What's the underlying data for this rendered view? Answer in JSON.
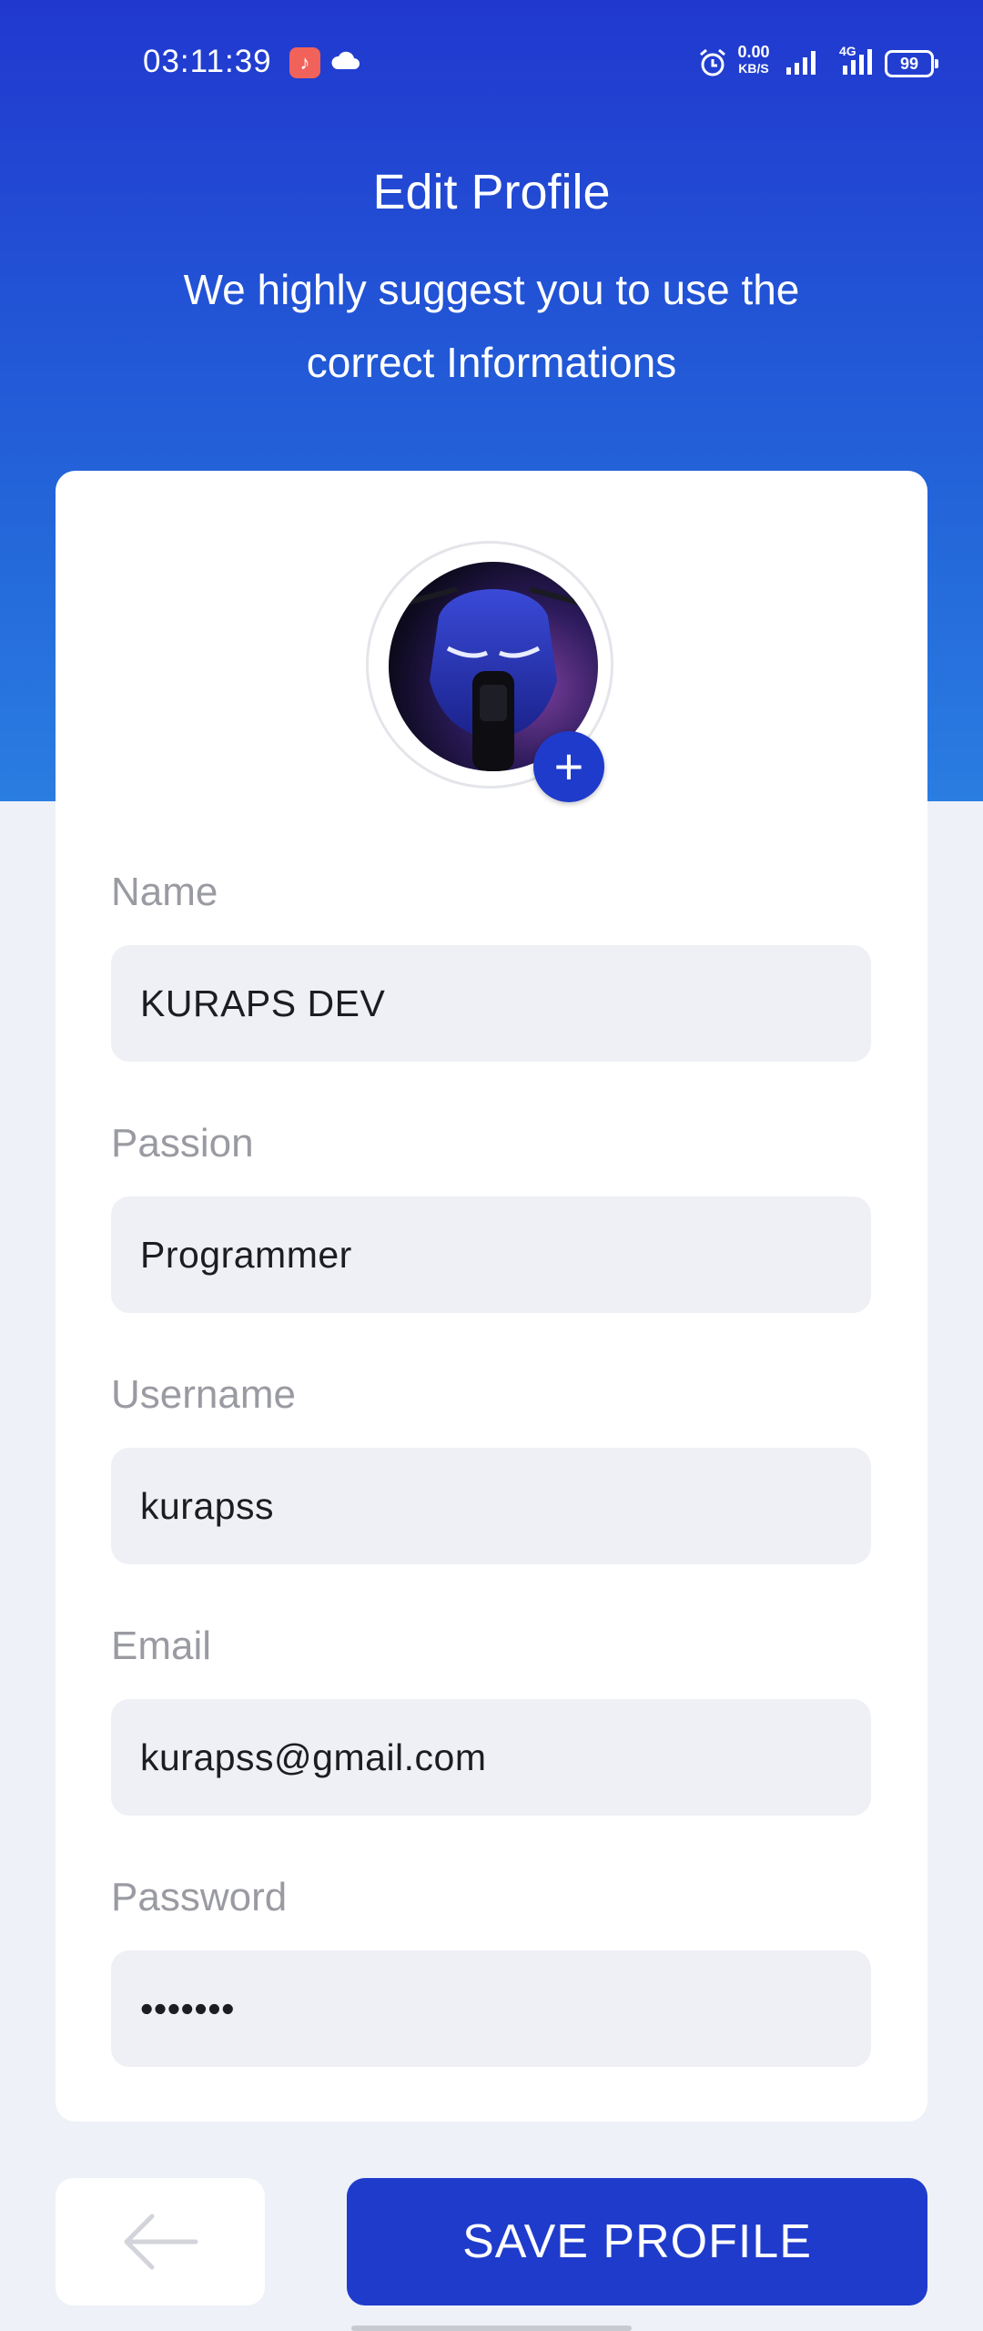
{
  "status_bar": {
    "time": "03:11:39",
    "net_speed": "0.00",
    "net_unit": "KB/S",
    "network": "4G",
    "battery": "99"
  },
  "header": {
    "title": "Edit Profile",
    "subtitle": "We highly suggest you to use the correct Informations"
  },
  "avatar": {
    "add_symbol": "+"
  },
  "form": {
    "fields": [
      {
        "label": "Name",
        "value": "KURAPS DEV"
      },
      {
        "label": "Passion",
        "value": "Programmer"
      },
      {
        "label": "Username",
        "value": "kurapss"
      },
      {
        "label": "Email",
        "value": "kurapss@gmail.com"
      },
      {
        "label": "Password",
        "value": "•••••••"
      }
    ]
  },
  "actions": {
    "back_icon": "arrow-left-icon",
    "save_label": "SAVE PROFILE"
  },
  "colors": {
    "primary": "#1f3bcc",
    "hero_gradient_top": "#2138cf",
    "hero_gradient_bottom": "#2a7de1",
    "background": "#eef1f8",
    "field_bg": "#eff0f5",
    "label_color": "#9a9ba2"
  }
}
